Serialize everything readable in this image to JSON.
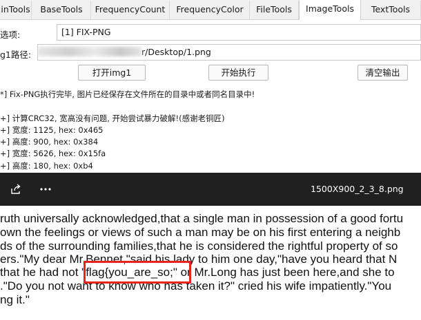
{
  "tabs": [
    {
      "label": "inTools"
    },
    {
      "label": "BaseTools"
    },
    {
      "label": "FrequencyCount"
    },
    {
      "label": "FrequencyColor"
    },
    {
      "label": "FileTools"
    },
    {
      "label": "ImageTools"
    },
    {
      "label": "TextTools"
    }
  ],
  "form": {
    "option_label": "选项:",
    "option_value": "[1] FIX-PNG",
    "path_label": "g1路径:",
    "path_value": "r/Desktop/1.png",
    "open_button": "打开img1",
    "start_button": "开始执行",
    "clear_button": "清空输出"
  },
  "log": [
    "*] Fix-PNG执行完毕, 图片已经保存在文件所在的目录中或者同名目录中!",
    "",
    "+] 计算CRC32, 宽高没有问题, 开始尝试暴力破解!(感谢老铜匠)",
    "+] 宽度: 1125, hex: 0x465",
    "+] 高度: 900, hex: 0x384",
    "+] 宽度: 5626, hex: 0x15fa",
    "+] 高度: 180, hex: 0xb4"
  ],
  "viewer": {
    "filename": "1500X900_2_3_8.png",
    "share_icon": "share-icon",
    "more_icon": "more-options-icon",
    "bar_color": "#202020"
  },
  "document": {
    "lines": [
      "ruth universally acknowledged,that a single man in possession of a good fortu",
      "own the feelings or views of such a man may be on his first entering a neighb",
      "ds of the surrounding families,that he is considered the rightful property of so",
      "ers.\"My dear Mr.Bennet,\"said his lady to him one day,\"have you heard that N",
      "that he had not \"flag{you_are_so;\" or Mr.Long has just been here,and she to",
      ".\"Do you not want to know who has taken it?\" cried his wife impatiently.\"You",
      "ng it.\""
    ],
    "highlight_color": "#e8231b"
  }
}
